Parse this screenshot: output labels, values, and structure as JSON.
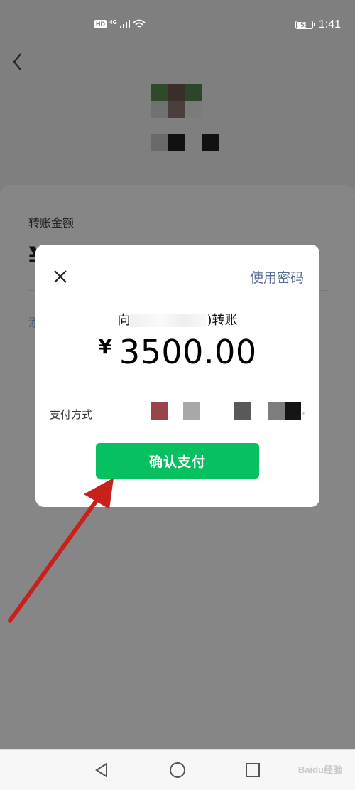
{
  "status_bar": {
    "hd": "HD",
    "network": "4G",
    "battery": "55",
    "battery_level": 0.55,
    "time": "1:41"
  },
  "background_screen": {
    "amount_label": "转账金额",
    "currency_symbol": "¥",
    "link_partial": "添"
  },
  "dialog": {
    "use_password": "使用密码",
    "payee_prefix": "向",
    "payee_suffix": ")转账",
    "currency_symbol": "¥",
    "amount": "3500.00",
    "payment_method_label": "支付方式",
    "confirm_button": "确认支付"
  },
  "watermark": "Baidu经验",
  "colors": {
    "overlay": "#7f7f7f",
    "confirm_green": "#07c160",
    "link_blue": "#576b95",
    "arrow_red": "#c9201c"
  },
  "icons": [
    "back-chevron-icon",
    "close-icon",
    "chevron-right-icon",
    "nav-back-icon",
    "nav-home-icon",
    "nav-recents-icon",
    "wifi-icon",
    "signal-icon"
  ]
}
